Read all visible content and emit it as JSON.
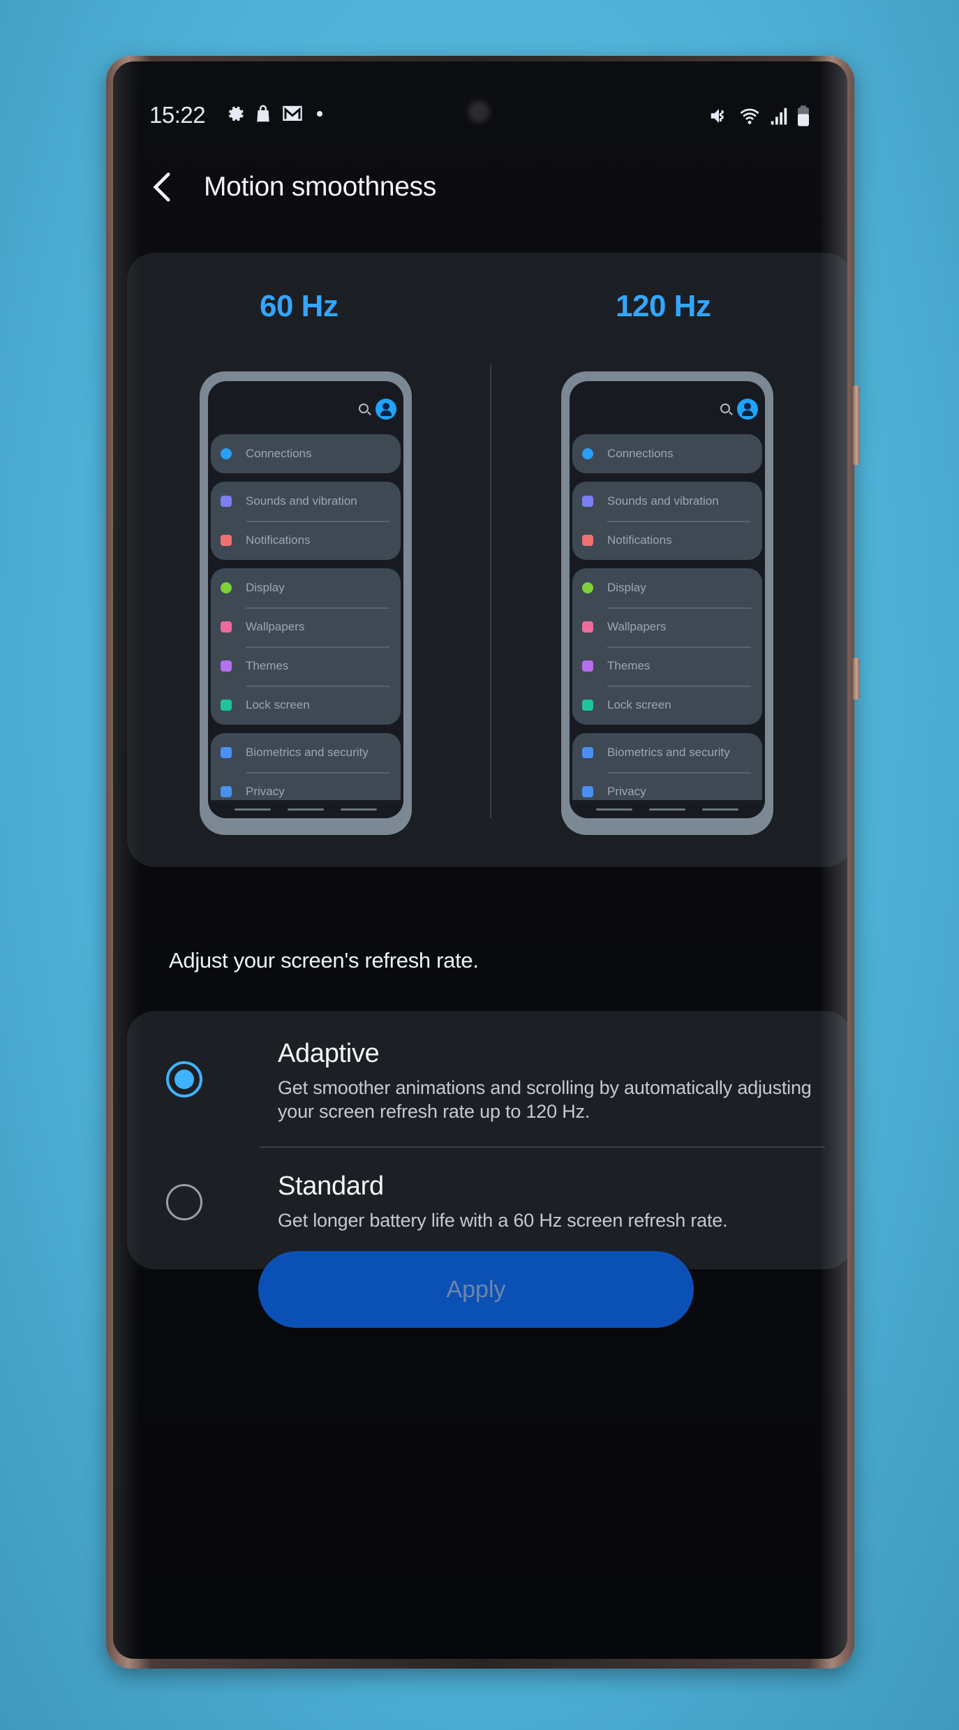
{
  "status_bar": {
    "time": "15:22",
    "left_icons": [
      "gear-icon",
      "shopping-bag-icon",
      "gmail-icon",
      "dot-icon"
    ],
    "right_icons": [
      "mute-icon",
      "wifi-icon",
      "signal-icon",
      "battery-icon"
    ]
  },
  "app_bar": {
    "back_icon": "chevron-left-icon",
    "title": "Motion smoothness"
  },
  "preview": {
    "panels": [
      {
        "label": "60 Hz",
        "groups": [
          [
            {
              "icon": "wifi-icon",
              "label": "Connections",
              "color": "#2a9df4"
            }
          ],
          [
            {
              "icon": "speaker-icon",
              "label": "Sounds and vibration",
              "color": "#7b7ff0"
            },
            {
              "icon": "notification-icon",
              "label": "Notifications",
              "color": "#f07070"
            }
          ],
          [
            {
              "icon": "sun-icon",
              "label": "Display",
              "color": "#7fd23a"
            },
            {
              "icon": "wallpaper-icon",
              "label": "Wallpapers",
              "color": "#ef6a9c"
            },
            {
              "icon": "brush-icon",
              "label": "Themes",
              "color": "#b46ef0"
            },
            {
              "icon": "lock-screen-icon",
              "label": "Lock screen",
              "color": "#22c29a"
            }
          ],
          [
            {
              "icon": "shield-icon",
              "label": "Biometrics and security",
              "color": "#4a90f0"
            },
            {
              "icon": "privacy-icon",
              "label": "Privacy",
              "color": "#4a90f0"
            }
          ]
        ]
      },
      {
        "label": "120 Hz",
        "groups": [
          [
            {
              "icon": "wifi-icon",
              "label": "Connections",
              "color": "#2a9df4"
            }
          ],
          [
            {
              "icon": "speaker-icon",
              "label": "Sounds and vibration",
              "color": "#7b7ff0"
            },
            {
              "icon": "notification-icon",
              "label": "Notifications",
              "color": "#f07070"
            }
          ],
          [
            {
              "icon": "sun-icon",
              "label": "Display",
              "color": "#7fd23a"
            },
            {
              "icon": "wallpaper-icon",
              "label": "Wallpapers",
              "color": "#ef6a9c"
            },
            {
              "icon": "brush-icon",
              "label": "Themes",
              "color": "#b46ef0"
            },
            {
              "icon": "lock-screen-icon",
              "label": "Lock screen",
              "color": "#22c29a"
            }
          ],
          [
            {
              "icon": "shield-icon",
              "label": "Biometrics and security",
              "color": "#4a90f0"
            },
            {
              "icon": "privacy-icon",
              "label": "Privacy",
              "color": "#4a90f0"
            }
          ]
        ]
      }
    ]
  },
  "description": "Adjust your screen's refresh rate.",
  "options": [
    {
      "title": "Adaptive",
      "description": "Get smoother animations and scrolling by automatically adjusting your screen refresh rate up to 120 Hz.",
      "selected": true
    },
    {
      "title": "Standard",
      "description": "Get longer battery life with a 60 Hz screen refresh rate.",
      "selected": false
    }
  ],
  "apply_button": {
    "label": "Apply",
    "enabled": false
  },
  "colors": {
    "accent": "#3fb3ff",
    "hz_label": "#33a6ff",
    "apply_bg": "#0b50b4"
  }
}
